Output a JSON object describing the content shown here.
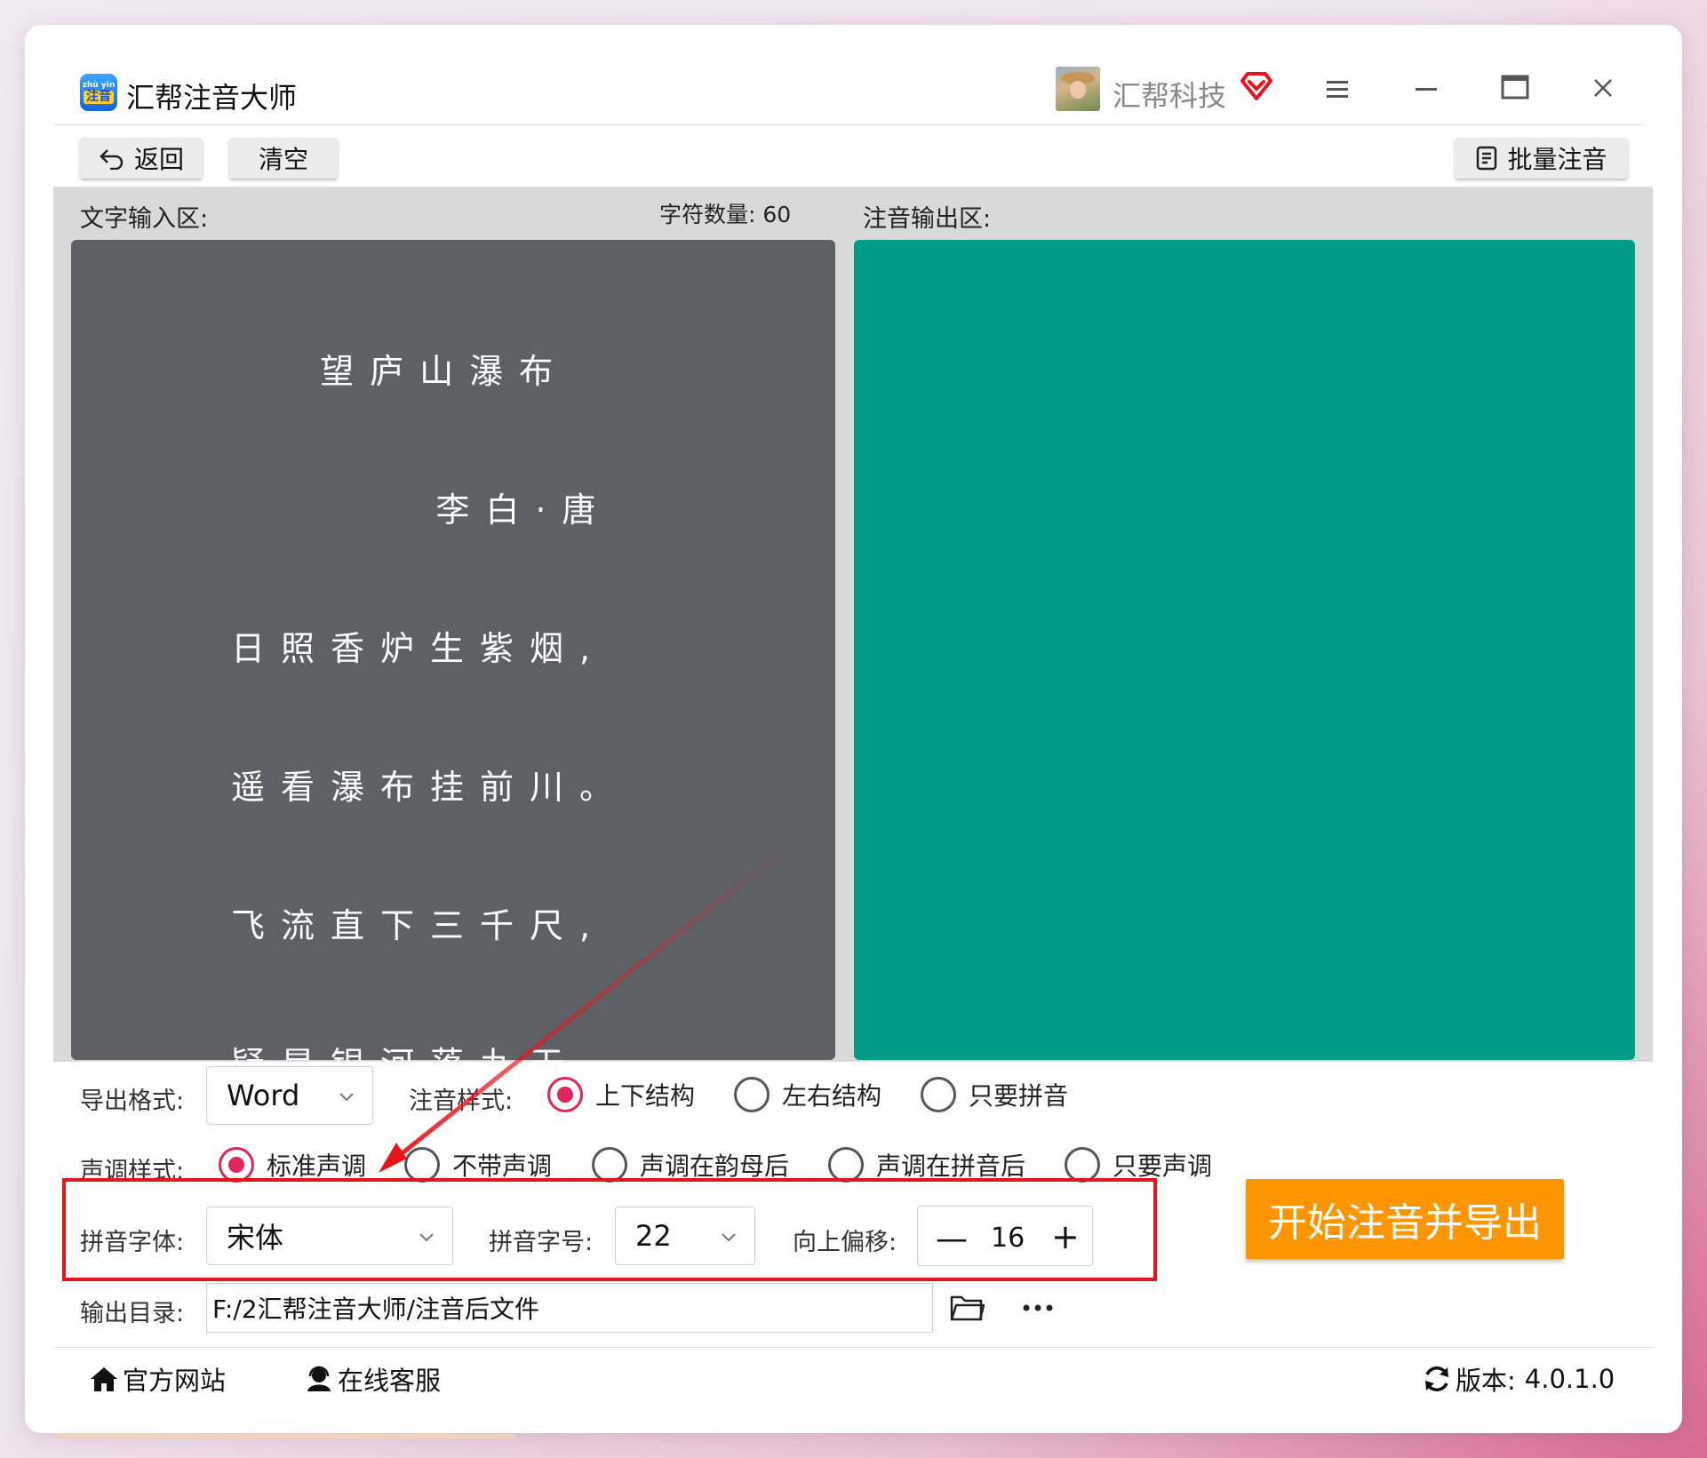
{
  "app": {
    "title": "汇帮注音大师",
    "logo_top": "zhù yīn",
    "logo_main": "注音"
  },
  "user": {
    "name": "汇帮科技"
  },
  "toolbar": {
    "back_label": "返回",
    "clear_label": "清空",
    "batch_label": "批量注音"
  },
  "input": {
    "label": "文字输入区:",
    "char_count_label": "字符数量:",
    "char_count": "60",
    "poem_lines": [
      "  望庐山瀑布",
      "    李白·唐",
      "日照香炉生紫烟,",
      "遥看瀑布挂前川。",
      "飞流直下三千尺,",
      "疑是银河落九天。"
    ]
  },
  "output": {
    "label": "注音输出区:"
  },
  "options": {
    "export_format_label": "导出格式:",
    "export_format_value": "Word",
    "annotation_style_label": "注音样式:",
    "annotation_styles": [
      "上下结构",
      "左右结构",
      "只要拼音"
    ],
    "annotation_selected": 0,
    "tone_style_label": "声调样式:",
    "tone_styles": [
      "标准声调",
      "不带声调",
      "声调在韵母后",
      "声调在拼音后",
      "只要声调"
    ],
    "tone_selected": 0,
    "pinyin_font_label": "拼音字体:",
    "pinyin_font_value": "宋体",
    "pinyin_size_label": "拼音字号:",
    "pinyin_size_value": "22",
    "offset_label": "向上偏移:",
    "offset_value": "16",
    "output_dir_label": "输出目录:",
    "output_dir_value": "F:/2汇帮注音大师/注音后文件"
  },
  "start_button": "开始注音并导出",
  "footer": {
    "website": "官方网站",
    "support": "在线客服",
    "version_label": "版本:",
    "version": "4.0.1.0"
  },
  "colors": {
    "accent": "#ff9600",
    "output_bg": "#009c8a",
    "input_bg": "#5f6066",
    "highlight": "#e8141b",
    "radio_on": "#e0245e"
  }
}
